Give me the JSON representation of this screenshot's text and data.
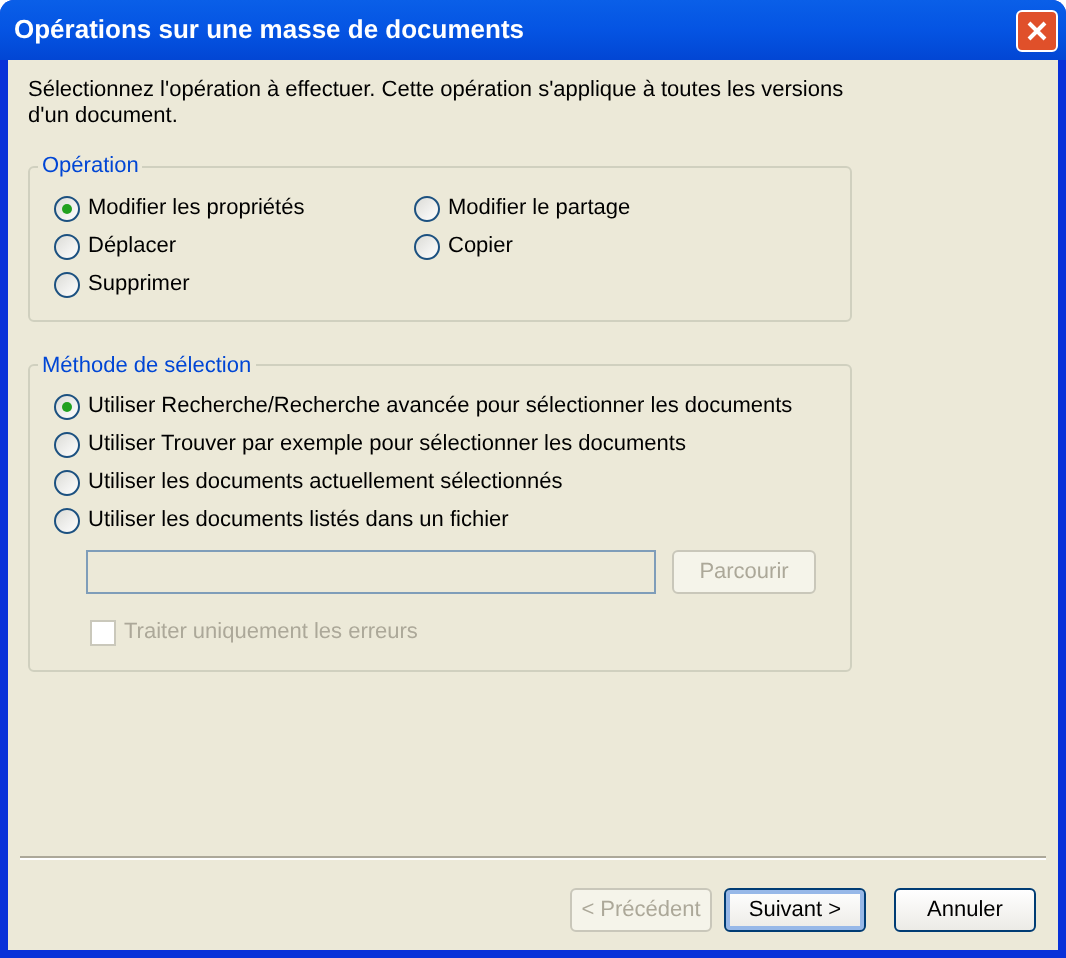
{
  "window": {
    "title": "Opérations sur une masse de documents"
  },
  "intro": "Sélectionnez l'opération à effectuer. Cette opération s'applique à toutes les versions d'un document.",
  "operation_group": {
    "title": "Opération",
    "options": [
      {
        "label": "Modifier les propriétés",
        "selected": true
      },
      {
        "label": "Modifier le partage",
        "selected": false
      },
      {
        "label": "Déplacer",
        "selected": false
      },
      {
        "label": "Copier",
        "selected": false
      },
      {
        "label": "Supprimer",
        "selected": false
      }
    ]
  },
  "selection_group": {
    "title": "Méthode de sélection",
    "options": [
      {
        "label": "Utiliser Recherche/Recherche avancée pour sélectionner les documents",
        "selected": true
      },
      {
        "label": "Utiliser Trouver par exemple pour sélectionner les documents",
        "selected": false
      },
      {
        "label": "Utiliser les documents actuellement sélectionnés",
        "selected": false
      },
      {
        "label": "Utiliser les documents listés dans un fichier",
        "selected": false
      }
    ],
    "file_field": {
      "disabled": true
    },
    "browse_button": {
      "label": "Parcourir",
      "disabled": true
    },
    "errors_only": {
      "label": "Traiter uniquement les erreurs",
      "checked": false,
      "disabled": true
    }
  },
  "buttons": [
    {
      "label": "< Précédent",
      "disabled": true,
      "default": false
    },
    {
      "label": "Suivant >",
      "disabled": false,
      "default": true
    },
    {
      "label": "Annuler",
      "disabled": false,
      "default": false
    }
  ]
}
